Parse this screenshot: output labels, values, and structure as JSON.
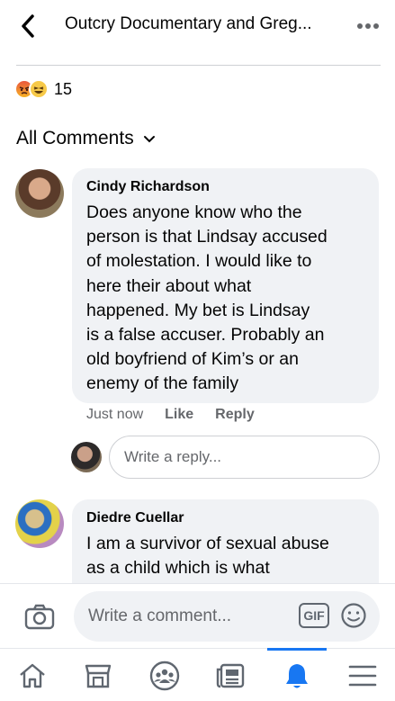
{
  "header": {
    "title": "Outcry Documentary and Greg...",
    "back_icon": "chevron-left-icon",
    "more_icon": "more-horizontal-icon"
  },
  "reactions": {
    "types": [
      "angry",
      "haha"
    ],
    "count": "15"
  },
  "filter": {
    "label": "All Comments"
  },
  "comments": [
    {
      "author": "Cindy Richardson",
      "lines": [
        "Does anyone know who the",
        "person is that Lindsay accused",
        "of molestation.  I would like to",
        "here their about what",
        "happened.  My bet is Lindsay",
        "is a false accuser.  Probably an",
        "old boyfriend of Kim’s or an",
        "enemy of the family"
      ],
      "time": "Just now",
      "like_label": "Like",
      "reply_label": "Reply"
    },
    {
      "author": "Diedre Cuellar",
      "lines": [
        "I am a survivor of sexual abuse",
        "as a child  which is what"
      ]
    }
  ],
  "reply_box": {
    "placeholder": "Write a reply..."
  },
  "composer": {
    "placeholder": "Write a comment...",
    "gif_label": "GIF"
  },
  "tabbar": {
    "active": "notifications",
    "tabs": [
      "home-icon",
      "marketplace-icon",
      "groups-icon",
      "news-icon",
      "notifications-icon",
      "menu-icon"
    ]
  },
  "colors": {
    "accent": "#1877f2",
    "bubble": "#f0f2f5",
    "muted_text": "#65676b"
  }
}
